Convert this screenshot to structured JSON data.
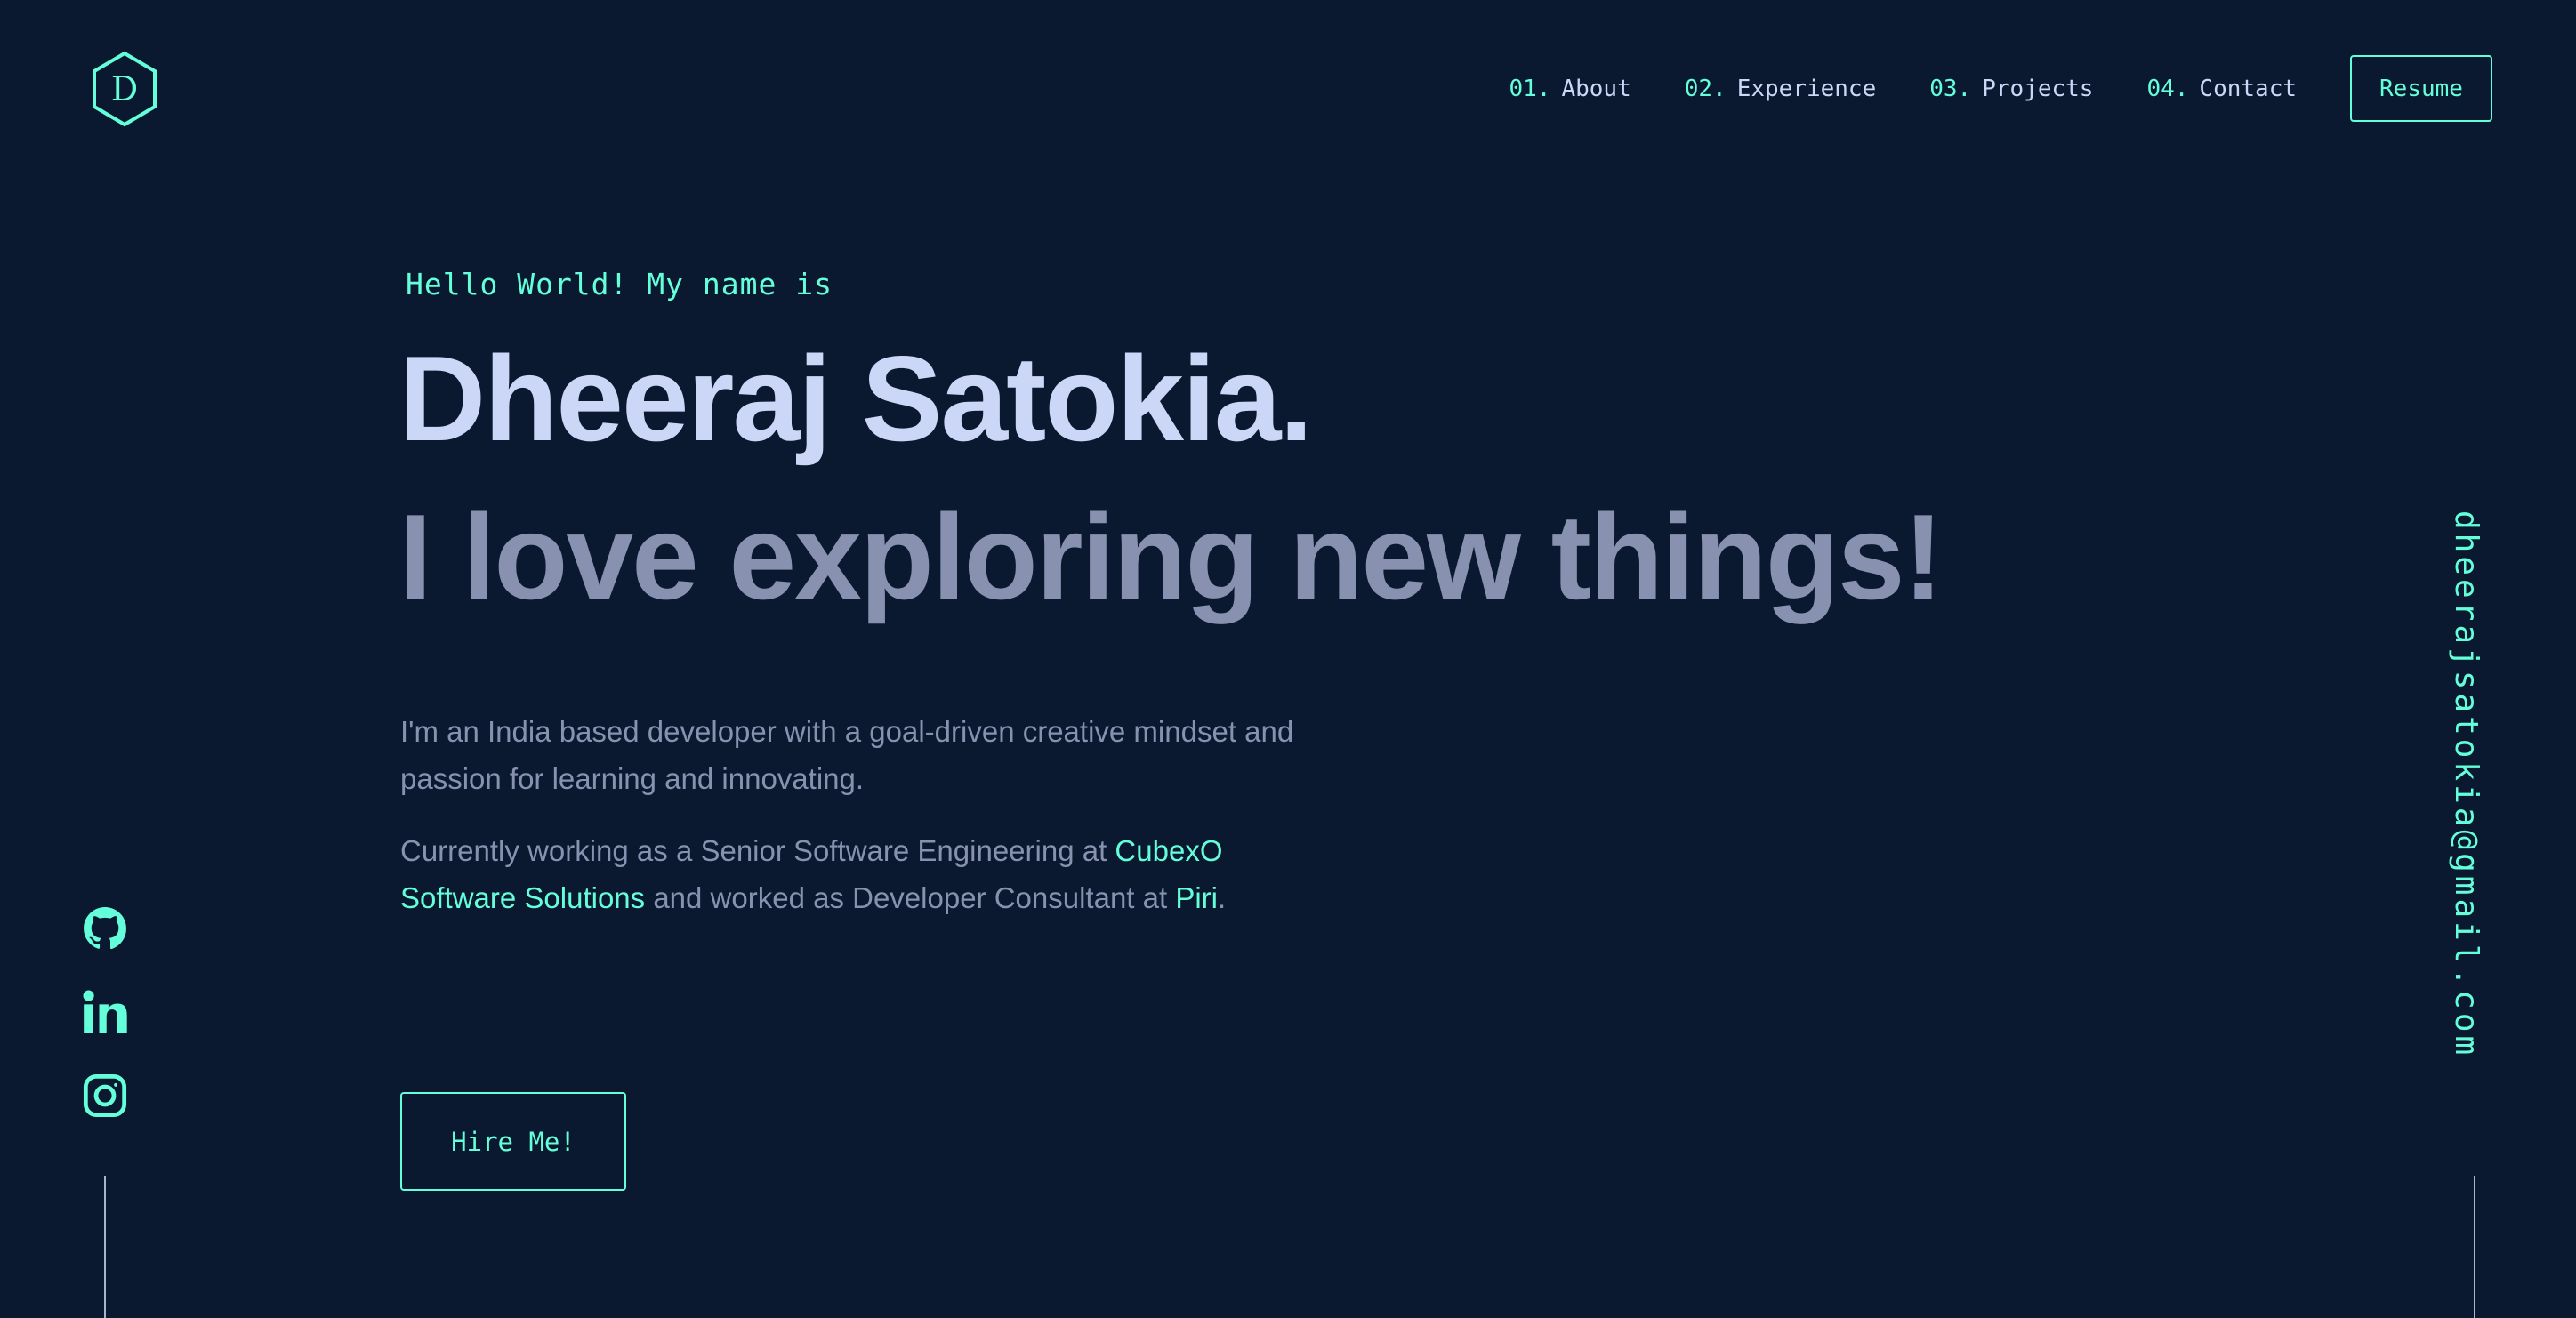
{
  "brand": {
    "logo_letter": "D",
    "accent_color": "#64ffda",
    "background_color": "#0a192f"
  },
  "nav": {
    "items": [
      {
        "num": "01.",
        "label": "About"
      },
      {
        "num": "02.",
        "label": "Experience"
      },
      {
        "num": "03.",
        "label": "Projects"
      },
      {
        "num": "04.",
        "label": "Contact"
      }
    ],
    "resume_label": "Resume"
  },
  "hero": {
    "intro": "Hello World! My name is",
    "name": "Dheeraj Satokia.",
    "tagline": "I love exploring new things!",
    "para1": "I'm an India based developer with a goal-driven creative mindset and passion for learning and innovating.",
    "para2_prefix": "Currently working as a Senior Software Engineering at ",
    "company_current": "CubexO Software Solutions",
    "para2_middle": " and worked as Developer Consultant at ",
    "company_previous": "Piri",
    "para2_suffix": ".",
    "cta_label": "Hire Me!"
  },
  "social": {
    "icons": [
      "github-icon",
      "linkedin-icon",
      "instagram-icon"
    ],
    "email": "dheerajsatokia@gmail.com"
  }
}
